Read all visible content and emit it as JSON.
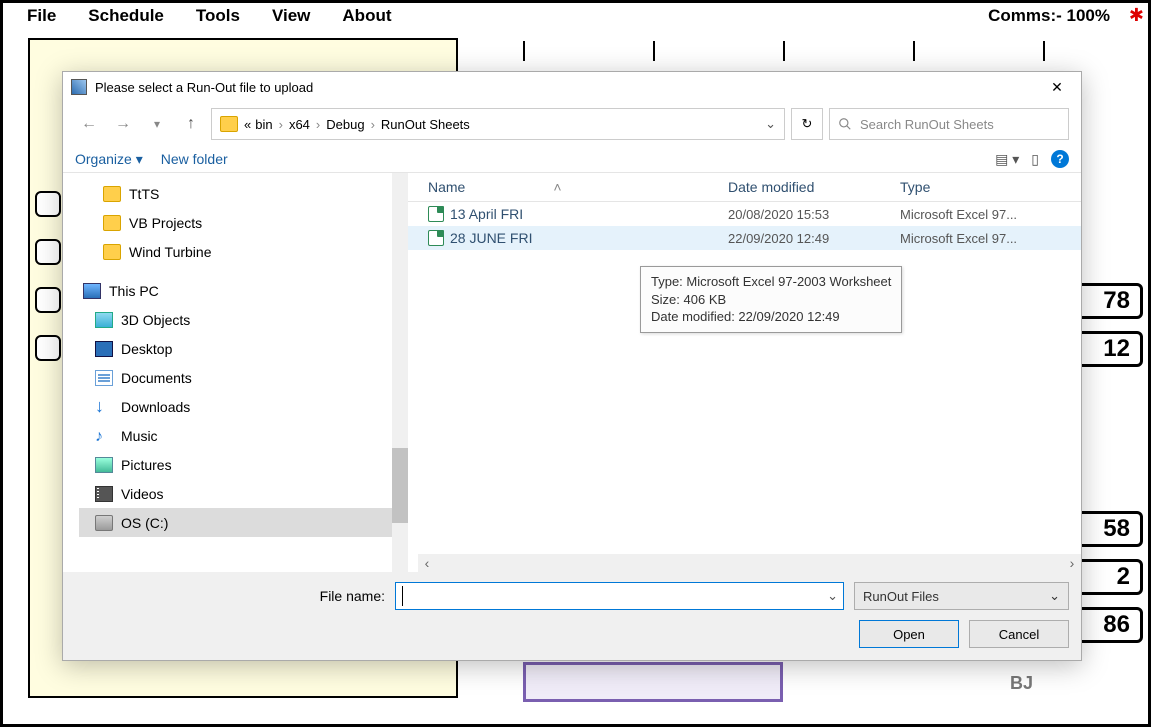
{
  "menubar": {
    "items": [
      "File",
      "Schedule",
      "Tools",
      "View",
      "About"
    ],
    "status": "Comms:- 100%"
  },
  "bg": {
    "vals": [
      "78",
      "12",
      "58",
      "2",
      "86"
    ],
    "bj": "BJ"
  },
  "dialog": {
    "title": "Please select a Run-Out file to upload",
    "breadcrumb": {
      "prefix": "«",
      "parts": [
        "bin",
        "x64",
        "Debug",
        "RunOut Sheets"
      ]
    },
    "search_placeholder": "Search RunOut Sheets",
    "toolbar": {
      "organize": "Organize",
      "newfolder": "New folder"
    },
    "tree": {
      "folders": [
        "TtTS",
        "VB Projects",
        "Wind Turbine"
      ],
      "pc": "This PC",
      "pcitems": [
        {
          "label": "3D Objects",
          "icon": "blue3d"
        },
        {
          "label": "Desktop",
          "icon": "desktop"
        },
        {
          "label": "Documents",
          "icon": "doc"
        },
        {
          "label": "Downloads",
          "icon": "down"
        },
        {
          "label": "Music",
          "icon": "music"
        },
        {
          "label": "Pictures",
          "icon": "pic"
        },
        {
          "label": "Videos",
          "icon": "video"
        },
        {
          "label": "OS (C:)",
          "icon": "drive",
          "selected": true
        }
      ]
    },
    "columns": {
      "name": "Name",
      "date": "Date modified",
      "type": "Type"
    },
    "files": [
      {
        "name": "13 April FRI",
        "date": "20/08/2020 15:53",
        "type": "Microsoft Excel 97..."
      },
      {
        "name": "28 JUNE FRI",
        "date": "22/09/2020 12:49",
        "type": "Microsoft Excel 97...",
        "selected": true
      }
    ],
    "tooltip": {
      "l1": "Type: Microsoft Excel 97-2003 Worksheet",
      "l2": "Size: 406 KB",
      "l3": "Date modified: 22/09/2020 12:49"
    },
    "filename_label": "File name:",
    "filetype": "RunOut Files",
    "open": "Open",
    "cancel": "Cancel"
  }
}
